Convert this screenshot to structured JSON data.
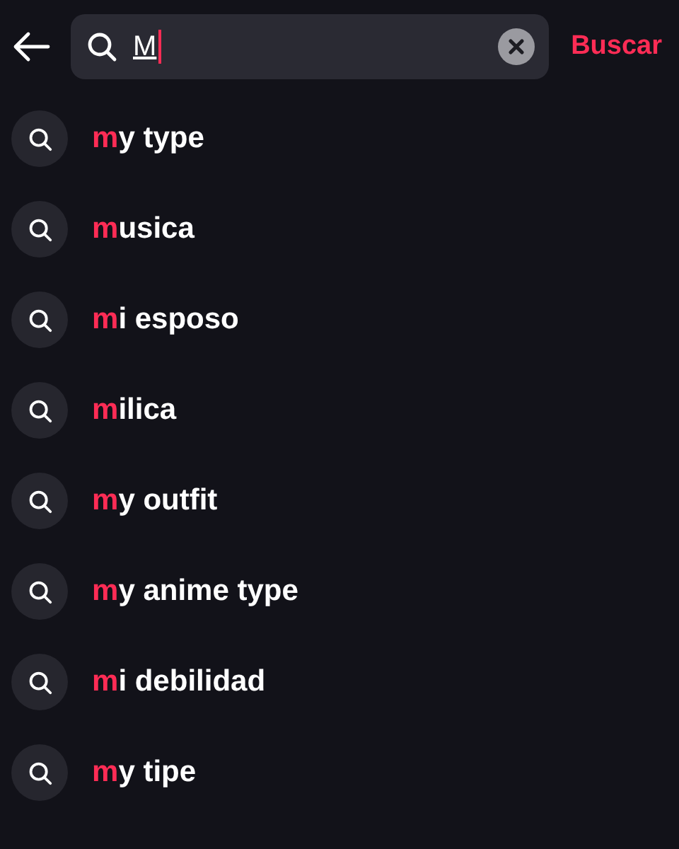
{
  "search": {
    "value": "M",
    "action": "Buscar"
  },
  "suggestions": [
    {
      "match": "m",
      "rest": "y type"
    },
    {
      "match": "m",
      "rest": "usica"
    },
    {
      "match": "m",
      "rest": "i esposo"
    },
    {
      "match": "m",
      "rest": "ilica"
    },
    {
      "match": "m",
      "rest": "y outfit"
    },
    {
      "match": "m",
      "rest": "y anime type"
    },
    {
      "match": "m",
      "rest": "i debilidad"
    },
    {
      "match": "m",
      "rest": "y tipe"
    }
  ]
}
